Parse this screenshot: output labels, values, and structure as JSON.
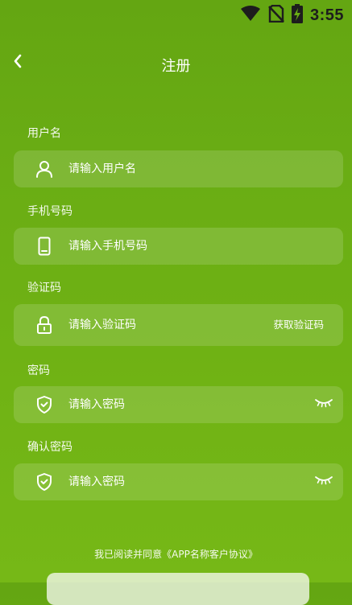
{
  "status_bar": {
    "time": "3:55",
    "icons": [
      "wifi-icon",
      "no-sim-icon",
      "battery-charging-icon"
    ]
  },
  "header": {
    "title": "注册",
    "back_icon": "chevron-left-icon"
  },
  "form": {
    "username": {
      "label": "用户名",
      "placeholder": "请输入用户名",
      "icon": "user-icon"
    },
    "phone": {
      "label": "手机号码",
      "placeholder": "请输入手机号码",
      "icon": "phone-icon"
    },
    "code": {
      "label": "验证码",
      "placeholder": "请输入验证码",
      "icon": "lock-icon",
      "action_label": "获取验证码"
    },
    "password": {
      "label": "密码",
      "placeholder": "请输入密码",
      "icon": "shield-icon",
      "toggle_icon": "eye-closed-icon"
    },
    "confirm_password": {
      "label": "确认密码",
      "placeholder": "请输入密码",
      "icon": "shield-icon",
      "toggle_icon": "eye-closed-icon"
    }
  },
  "agreement": {
    "text": "我已阅读并同意《APP名称客户协议》"
  },
  "colors": {
    "background_top": "#64a612",
    "background_bottom": "#76b817",
    "field_fill": "rgba(255,255,255,0.14)",
    "status_text": "#1d1d1d"
  }
}
